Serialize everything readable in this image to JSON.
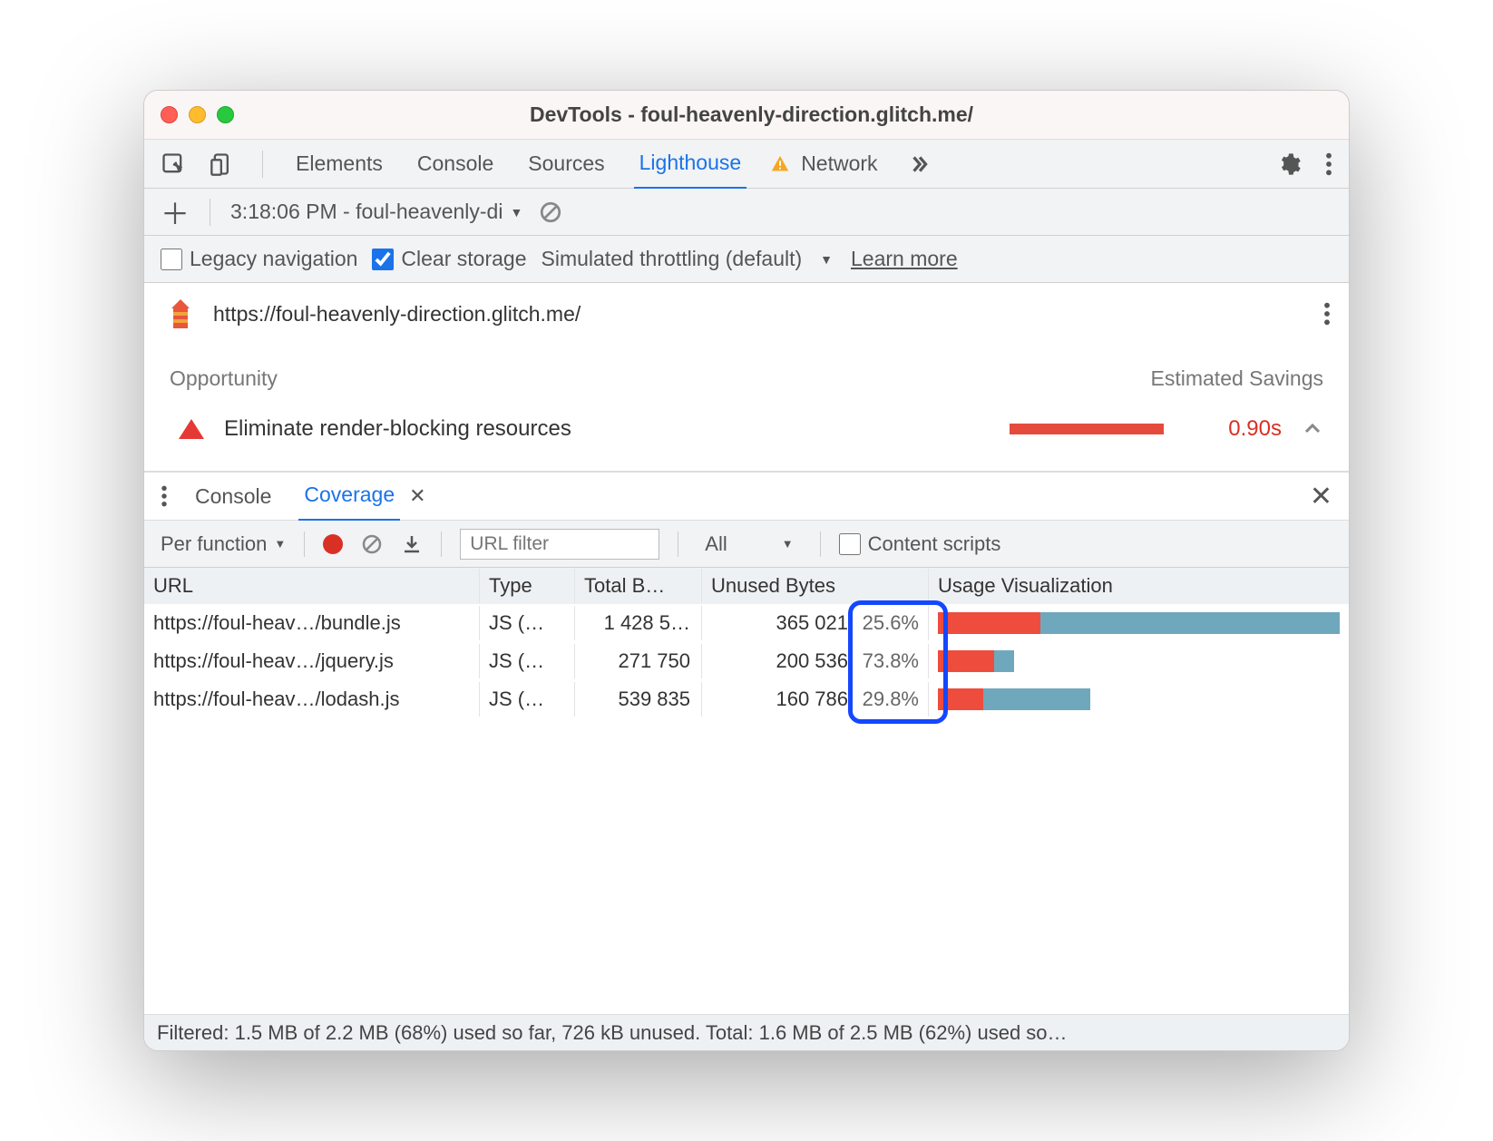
{
  "window": {
    "title": "DevTools - foul-heavenly-direction.glitch.me/"
  },
  "tabs": {
    "items": [
      "Elements",
      "Console",
      "Sources",
      "Lighthouse",
      "Network"
    ],
    "active": "Lighthouse",
    "warning": "Network"
  },
  "secondary": {
    "run_label": "3:18:06 PM - foul-heavenly-di"
  },
  "options": {
    "legacy_label": "Legacy navigation",
    "legacy_checked": false,
    "clear_label": "Clear storage",
    "clear_checked": true,
    "throttle_label": "Simulated throttling (default)",
    "learn_more": "Learn more"
  },
  "url_bar": {
    "url": "https://foul-heavenly-direction.glitch.me/"
  },
  "audit": {
    "col_left": "Opportunity",
    "col_right": "Estimated Savings",
    "item_label": "Eliminate render-blocking resources",
    "item_savings": "0.90s"
  },
  "drawer": {
    "tabs": [
      "Console",
      "Coverage"
    ],
    "active": "Coverage"
  },
  "cov_toolbar": {
    "mode": "Per function",
    "url_filter_placeholder": "URL filter",
    "type_filter": "All",
    "content_scripts": "Content scripts"
  },
  "cov_headers": [
    "URL",
    "Type",
    "Total B…",
    "Unused Bytes",
    "Usage Visualization"
  ],
  "cov_rows": [
    {
      "url": "https://foul-heav…/bundle.js",
      "type": "JS (…",
      "total": "1 428 5…",
      "unused": "365 021",
      "pct": "25.6%",
      "red": 25.6,
      "blue": 74.4,
      "width": 100
    },
    {
      "url": "https://foul-heav…/jquery.js",
      "type": "JS (…",
      "total": "271 750",
      "unused": "200 536",
      "pct": "73.8%",
      "red": 73.8,
      "blue": 26.2,
      "width": 19
    },
    {
      "url": "https://foul-heav…/lodash.js",
      "type": "JS (…",
      "total": "539 835",
      "unused": "160 786",
      "pct": "29.8%",
      "red": 29.8,
      "blue": 70.2,
      "width": 38
    }
  ],
  "status": "Filtered: 1.5 MB of 2.2 MB (68%) used so far, 726 kB unused. Total: 1.6 MB of 2.5 MB (62%) used so…"
}
